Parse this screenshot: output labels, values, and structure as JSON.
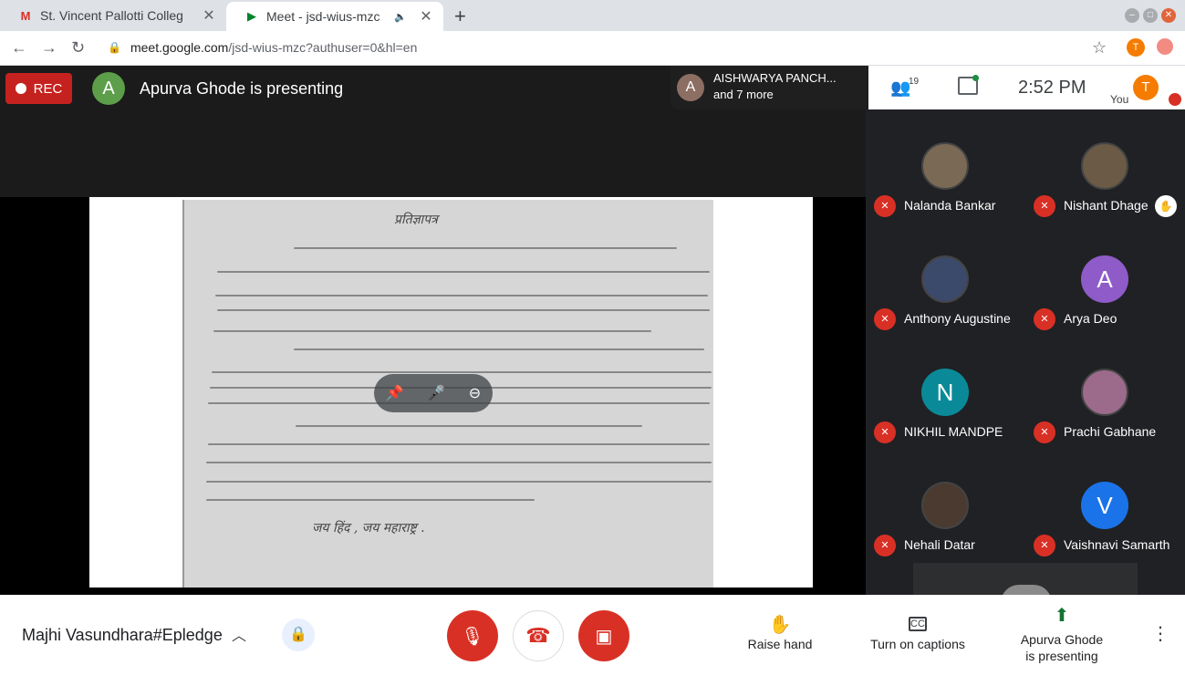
{
  "browser": {
    "tabs": [
      {
        "title": "St. Vincent Pallotti Colleg",
        "favicon": "M",
        "active": false
      },
      {
        "title": "Meet - jsd-wius-mzc",
        "favicon": "M",
        "active": true
      }
    ],
    "url_host": "meet.google.com",
    "url_path": "/jsd-wius-mzc?authuser=0&hl=en",
    "profile_initial": "T"
  },
  "meet": {
    "rec_label": "REC",
    "presenter_initial": "A",
    "presenting_text": "Apurva Ghode is presenting",
    "notification": {
      "initial": "A",
      "line1": "AISHWARYA PANCH...",
      "line2": "and 7 more"
    },
    "people_count": "19",
    "time": "2:52  PM",
    "you_label": "You",
    "you_initial": "T",
    "document": {
      "title": "प्रतिज्ञापत्र",
      "footer": "जय हिंद , जय महाराष्ट्र ."
    },
    "participants": [
      {
        "name": "Nalanda Bankar",
        "initial": "",
        "color": "#7a6a55",
        "hand": false
      },
      {
        "name": "Nishant Dhage",
        "initial": "",
        "color": "#6b5a45",
        "hand": true
      },
      {
        "name": "Anthony Augustine",
        "initial": "",
        "color": "#3b4a6b",
        "hand": false
      },
      {
        "name": "Arya Deo",
        "initial": "A",
        "color": "#8e5bc8",
        "hand": false
      },
      {
        "name": "NIKHIL MANDPE",
        "initial": "N",
        "color": "#0a8a98",
        "hand": false
      },
      {
        "name": "Prachi Gabhane",
        "initial": "",
        "color": "#9c6a8a",
        "hand": false
      },
      {
        "name": "Nehali Datar",
        "initial": "",
        "color": "#4a3a30",
        "hand": false
      },
      {
        "name": "Vaishnavi Samarth",
        "initial": "V",
        "color": "#1a73e8",
        "hand": false
      }
    ]
  },
  "bottom": {
    "meeting_name": "Majhi Vasundhara#Epledge",
    "raise_hand": "Raise hand",
    "captions": "Turn on captions",
    "captions_icon": "CC",
    "presenting_line1": "Apurva Ghode",
    "presenting_line2": "is presenting"
  }
}
